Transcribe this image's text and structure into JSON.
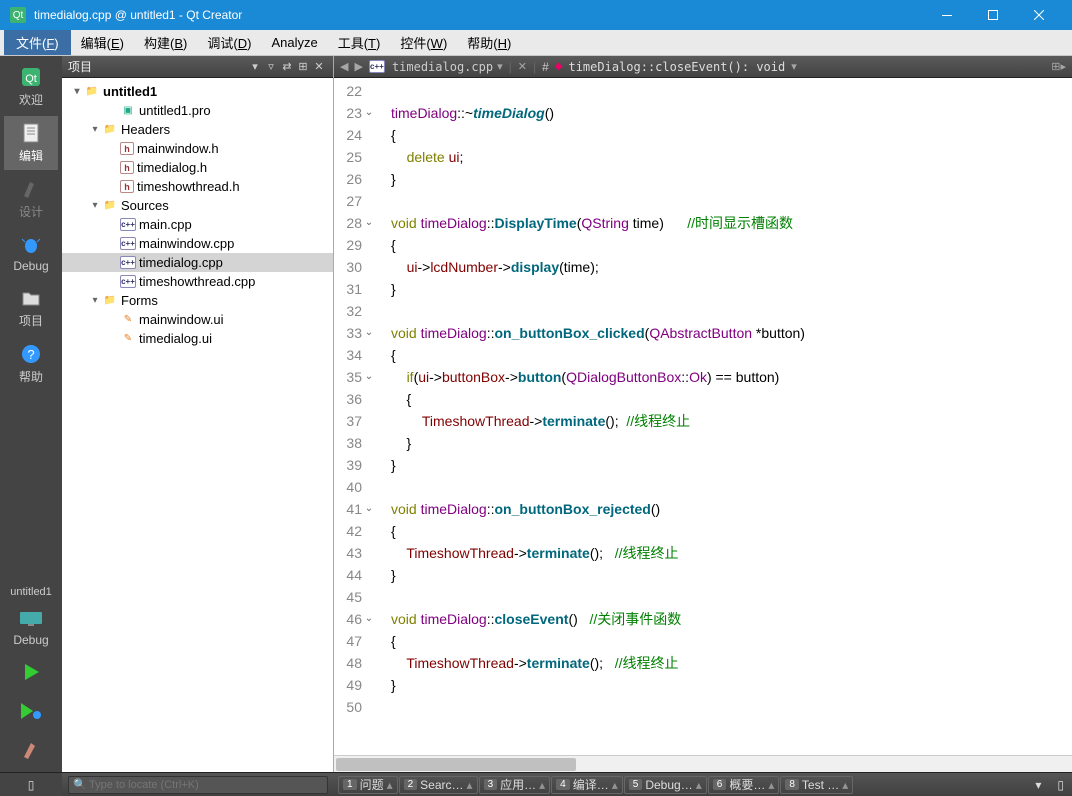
{
  "window": {
    "title": "timedialog.cpp @ untitled1 - Qt Creator"
  },
  "menus": [
    {
      "label": "文件",
      "key": "F",
      "first": true
    },
    {
      "label": "编辑",
      "key": "E"
    },
    {
      "label": "构建",
      "key": "B"
    },
    {
      "label": "调试",
      "key": "D"
    },
    {
      "label": "Analyze",
      "key": ""
    },
    {
      "label": "工具",
      "key": "T"
    },
    {
      "label": "控件",
      "key": "W"
    },
    {
      "label": "帮助",
      "key": "H"
    }
  ],
  "sidebar": {
    "items": [
      {
        "name": "welcome",
        "label": "欢迎",
        "active": false
      },
      {
        "name": "edit",
        "label": "编辑",
        "active": true
      },
      {
        "name": "design",
        "label": "设计",
        "dim": true
      },
      {
        "name": "debug",
        "label": "Debug"
      },
      {
        "name": "project",
        "label": "项目"
      },
      {
        "name": "help",
        "label": "帮助"
      }
    ],
    "project_label": "untitled1",
    "debug_label": "Debug"
  },
  "project_panel": {
    "header": "项目"
  },
  "tree": [
    {
      "d": 0,
      "exp": "v",
      "ico": "proj",
      "label": "untitled1",
      "root": true
    },
    {
      "d": 2,
      "exp": "",
      "ico": "pro",
      "label": "untitled1.pro"
    },
    {
      "d": 1,
      "exp": "v",
      "ico": "fold",
      "label": "Headers"
    },
    {
      "d": 2,
      "exp": "",
      "ico": "h",
      "label": "mainwindow.h"
    },
    {
      "d": 2,
      "exp": "",
      "ico": "h",
      "label": "timedialog.h"
    },
    {
      "d": 2,
      "exp": "",
      "ico": "h",
      "label": "timeshowthread.h"
    },
    {
      "d": 1,
      "exp": "v",
      "ico": "fold",
      "label": "Sources"
    },
    {
      "d": 2,
      "exp": "",
      "ico": "cpp",
      "label": "main.cpp"
    },
    {
      "d": 2,
      "exp": "",
      "ico": "cpp",
      "label": "mainwindow.cpp"
    },
    {
      "d": 2,
      "exp": "",
      "ico": "cpp",
      "label": "timedialog.cpp",
      "sel": true
    },
    {
      "d": 2,
      "exp": "",
      "ico": "cpp",
      "label": "timeshowthread.cpp"
    },
    {
      "d": 1,
      "exp": "v",
      "ico": "fold",
      "label": "Forms"
    },
    {
      "d": 2,
      "exp": "",
      "ico": "ui",
      "label": "mainwindow.ui"
    },
    {
      "d": 2,
      "exp": "",
      "ico": "ui",
      "label": "timedialog.ui"
    }
  ],
  "editor": {
    "filename": "timedialog.cpp",
    "breadcrumb": "timeDialog::closeEvent(): void"
  },
  "code": [
    {
      "n": 22,
      "html": ""
    },
    {
      "n": 23,
      "fold": "v",
      "html": "<span class='type'>timeDialog</span>::~<span class='fni'>timeDialog</span>()"
    },
    {
      "n": 24,
      "html": "{"
    },
    {
      "n": 25,
      "html": "    <span class='kw'>delete</span> <span class='var'>ui</span>;"
    },
    {
      "n": 26,
      "html": "}"
    },
    {
      "n": 27,
      "html": ""
    },
    {
      "n": 28,
      "fold": "v",
      "html": "<span class='kw'>void</span> <span class='type'>timeDialog</span>::<span class='fn'>DisplayTime</span>(<span class='type'>QString</span> time)      <span class='cmt'>//时间显示槽函数</span>"
    },
    {
      "n": 29,
      "html": "{"
    },
    {
      "n": 30,
      "html": "    <span class='var'>ui</span>-&gt;<span class='var'>lcdNumber</span>-&gt;<span class='fn'>display</span>(time);"
    },
    {
      "n": 31,
      "html": "}"
    },
    {
      "n": 32,
      "html": ""
    },
    {
      "n": 33,
      "fold": "v",
      "html": "<span class='kw'>void</span> <span class='type'>timeDialog</span>::<span class='fn'>on_buttonBox_clicked</span>(<span class='type'>QAbstractButton</span> *button)"
    },
    {
      "n": 34,
      "html": "{"
    },
    {
      "n": 35,
      "fold": "v",
      "html": "    <span class='kw'>if</span>(<span class='var'>ui</span>-&gt;<span class='var'>buttonBox</span>-&gt;<span class='fn'>button</span>(<span class='type'>QDialogButtonBox</span>::<span class='type'>Ok</span>) == button)"
    },
    {
      "n": 36,
      "html": "    {"
    },
    {
      "n": 37,
      "html": "        <span class='var'>TimeshowThread</span>-&gt;<span class='fn'>terminate</span>();  <span class='cmt'>//线程终止</span>"
    },
    {
      "n": 38,
      "html": "    }"
    },
    {
      "n": 39,
      "html": "}"
    },
    {
      "n": 40,
      "html": ""
    },
    {
      "n": 41,
      "fold": "v",
      "html": "<span class='kw'>void</span> <span class='type'>timeDialog</span>::<span class='fn'>on_buttonBox_rejected</span>()"
    },
    {
      "n": 42,
      "html": "{"
    },
    {
      "n": 43,
      "html": "    <span class='var'>TimeshowThread</span>-&gt;<span class='fn'>terminate</span>();   <span class='cmt'>//线程终止</span>"
    },
    {
      "n": 44,
      "html": "}"
    },
    {
      "n": 45,
      "mod": true,
      "html": ""
    },
    {
      "n": 46,
      "mod": true,
      "fold": "v",
      "html": "<span class='kw'>void</span> <span class='type'>timeDialog</span>::<span class='fn'>closeEvent</span>()   <span class='cmt'>//关闭事件函数</span>"
    },
    {
      "n": 47,
      "mod": true,
      "html": "{"
    },
    {
      "n": 48,
      "mod": true,
      "html": "    <span class='var'>TimeshowThread</span>-&gt;<span class='fn'>terminate</span>();   <span class='cmt'>//线程终止</span>"
    },
    {
      "n": 49,
      "mod": true,
      "html": "}"
    },
    {
      "n": 50,
      "mod": true,
      "html": ""
    }
  ],
  "status": {
    "search_placeholder": "Type to locate (Ctrl+K)",
    "panes": [
      {
        "n": "1",
        "label": "问题"
      },
      {
        "n": "2",
        "label": "Searc…"
      },
      {
        "n": "3",
        "label": "应用…"
      },
      {
        "n": "4",
        "label": "编译…"
      },
      {
        "n": "5",
        "label": "Debug…"
      },
      {
        "n": "6",
        "label": "概要…"
      },
      {
        "n": "8",
        "label": "Test …"
      }
    ]
  }
}
